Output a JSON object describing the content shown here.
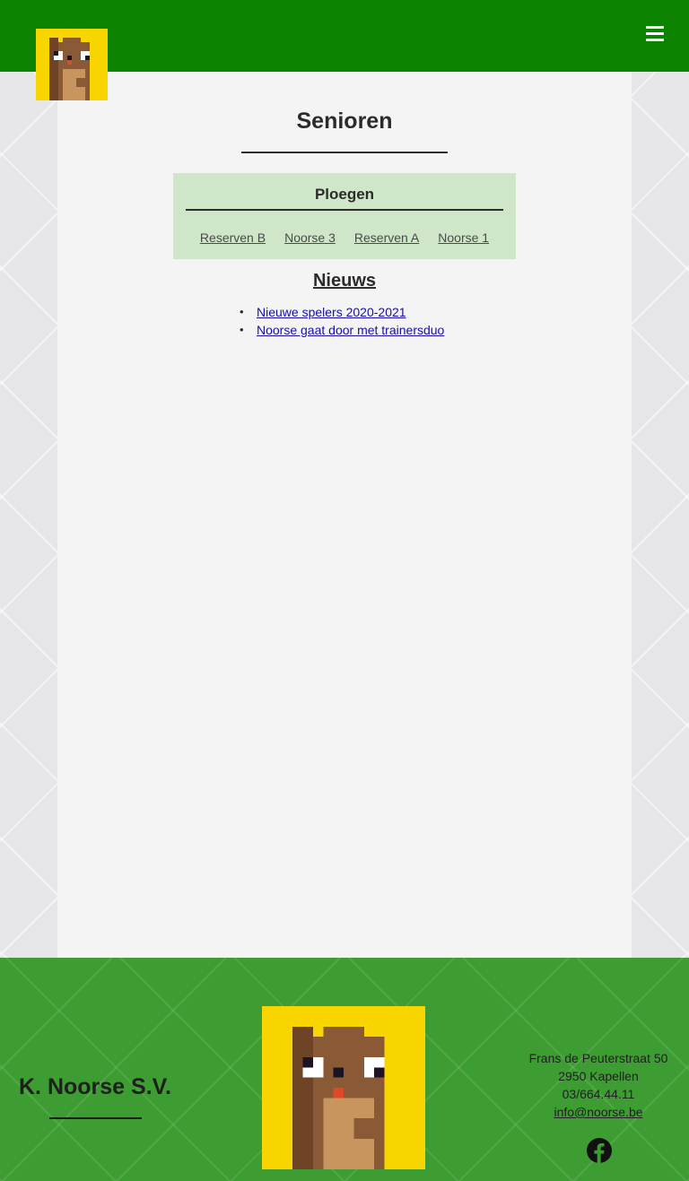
{
  "header": {
    "logo_icon": "club-mascot-pixel-logo",
    "menu_icon": "hamburger-menu-icon",
    "brand_color": "#0b8200"
  },
  "main": {
    "title": "Senioren",
    "teams": {
      "title": "Ploegen",
      "links": [
        "Reserven B",
        "Noorse 3",
        "Reserven A",
        "Noorse 1"
      ],
      "background": "#cfe6c8"
    },
    "news": {
      "title": "Nieuws",
      "items": [
        "Nieuwe spelers 2020-2021",
        "Noorse gaat door met trainersduo"
      ]
    }
  },
  "footer": {
    "club_name": "K. Noorse S.V.",
    "address": {
      "street": "Frans de Peuterstraat 50",
      "city": "2950 Kapellen",
      "phone": "03/664.44.11",
      "email": "info@noorse.be"
    },
    "social_icon": "facebook-icon",
    "background": "#3d9c32"
  }
}
